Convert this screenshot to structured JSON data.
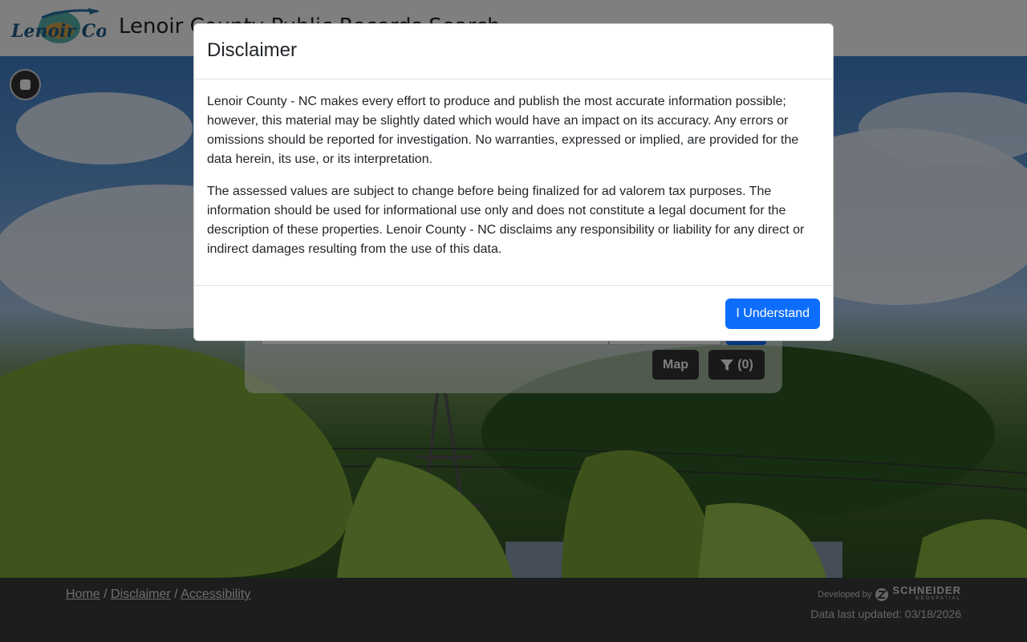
{
  "header": {
    "logo_text": "Lenoir County",
    "site_title": "Lenoir County Public Records Search"
  },
  "search": {
    "map_label": "Map",
    "filter_count": "(0)"
  },
  "modal": {
    "title": "Disclaimer",
    "paragraph1": "Lenoir County - NC makes every effort to produce and publish the most accurate information possible; however, this material may be slightly dated which would have an impact on its accuracy. Any errors or omissions should be reported for investigation. No warranties, expressed or implied, are provided for the data herein, its use, or its interpretation.",
    "paragraph2": "The assessed values are subject to change before being finalized for ad valorem tax purposes. The information should be used for informational use only and does not constitute a legal document for the description of these properties. Lenoir County - NC disclaims any responsibility or liability for any direct or indirect damages resulting from the use of this data.",
    "button_label": "I Understand"
  },
  "footer": {
    "links": [
      "Home",
      "Disclaimer",
      "Accessibility"
    ],
    "separator": "/",
    "developed_by": "Developed by",
    "brand_name": "SCHNEIDER",
    "brand_sub": "GEOSPATIAL",
    "data_updated": "Data last updated: 03/18/2026"
  },
  "colors": {
    "primary": "#0d6efd",
    "footer_bg": "#3a3a3a",
    "dark_button": "#333333"
  }
}
